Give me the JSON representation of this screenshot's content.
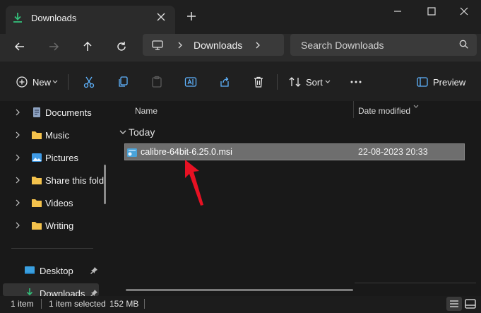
{
  "window": {
    "tab_title": "Downloads",
    "new_tab_icon": "plus-icon",
    "tab_close_icon": "close-icon",
    "controls": [
      "minimize-icon",
      "maximize-icon",
      "close-icon"
    ]
  },
  "navigation": {
    "buttons": [
      "back-icon",
      "forward-icon",
      "up-icon",
      "refresh-icon"
    ],
    "address": {
      "root_icon": "this-pc-icon",
      "crumb": "Downloads"
    },
    "search": {
      "placeholder": "Search Downloads"
    }
  },
  "toolbar": {
    "new_label": "New",
    "sort_label": "Sort",
    "preview_label": "Preview",
    "icons": [
      "cut-icon",
      "copy-icon",
      "paste-icon",
      "rename-icon",
      "share-icon",
      "delete-icon",
      "more-icon"
    ]
  },
  "sidebar": {
    "items": [
      {
        "label": "Documents",
        "icon": "documents-icon"
      },
      {
        "label": "Music",
        "icon": "folder-icon"
      },
      {
        "label": "Pictures",
        "icon": "pictures-icon"
      },
      {
        "label": "Share this fold",
        "icon": "folder-icon"
      },
      {
        "label": "Videos",
        "icon": "folder-icon"
      },
      {
        "label": "Writing",
        "icon": "folder-icon"
      }
    ],
    "quick_access": [
      {
        "label": "Desktop",
        "icon": "desktop-icon"
      },
      {
        "label": "Downloads",
        "icon": "download-icon"
      }
    ]
  },
  "file_list": {
    "columns": [
      "Name",
      "Date modified"
    ],
    "groups": [
      {
        "label": "Today",
        "files": [
          {
            "name": "calibre-64bit-6.25.0.msi",
            "date": "22-08-2023 20:33",
            "icon": "msi-installer-icon",
            "selected": true
          }
        ]
      }
    ]
  },
  "status": {
    "count": "1 item",
    "selected": "1 item selected",
    "size": "152 MB"
  },
  "colors": {
    "accent": "#e81123",
    "folder": "#f4c24c",
    "selection": "#6e6e6e"
  }
}
